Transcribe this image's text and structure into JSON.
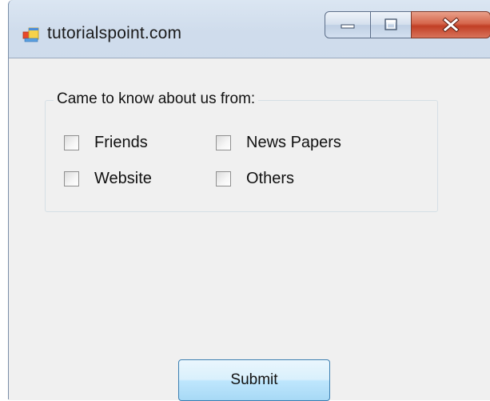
{
  "window": {
    "title": "tutorialspoint.com",
    "controls": {
      "minimize": "minimize",
      "maximize": "maximize",
      "close": "close"
    }
  },
  "form": {
    "group_title": "Came to know about us from:",
    "checkboxes": [
      {
        "label": "Friends",
        "checked": false
      },
      {
        "label": "News Papers",
        "checked": false
      },
      {
        "label": "Website",
        "checked": false
      },
      {
        "label": "Others",
        "checked": false
      }
    ],
    "submit_label": "Submit"
  },
  "colors": {
    "close_button": "#c94a30",
    "client_background": "#f0f0f0",
    "submit_border": "#3c7fb1"
  }
}
